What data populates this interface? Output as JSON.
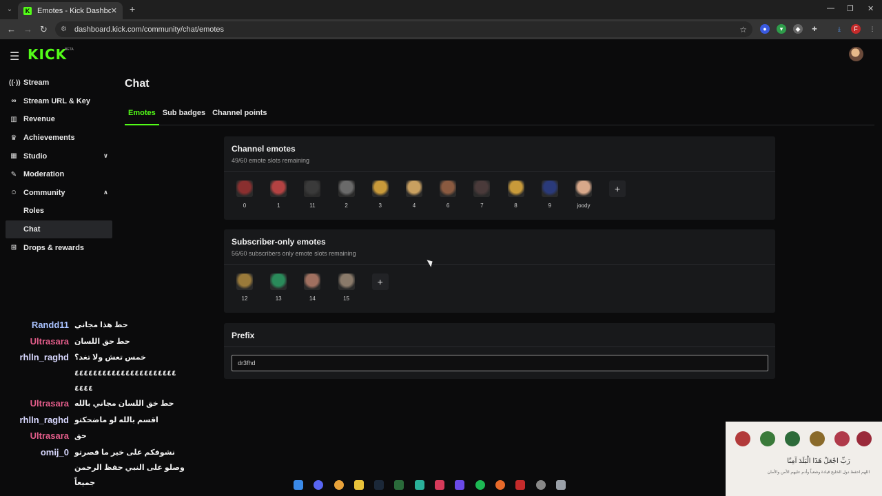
{
  "browser": {
    "tab_title": "Emotes - Kick Dashboard",
    "url": "dashboard.kick.com/community/chat/emotes"
  },
  "header": {
    "logo": "KICK",
    "logo_badge": "BETA"
  },
  "sidebar": {
    "items": [
      {
        "label": "Stream",
        "icon": "broadcast-icon"
      },
      {
        "label": "Stream URL & Key",
        "icon": "link-icon"
      },
      {
        "label": "Revenue",
        "icon": "chart-icon"
      },
      {
        "label": "Achievements",
        "icon": "trophy-icon"
      },
      {
        "label": "Studio",
        "icon": "layout-icon"
      },
      {
        "label": "Moderation",
        "icon": "wrench-icon"
      },
      {
        "label": "Community",
        "icon": "users-icon"
      },
      {
        "label": "Roles"
      },
      {
        "label": "Chat"
      },
      {
        "label": "Drops & rewards",
        "icon": "gift-icon"
      }
    ]
  },
  "main": {
    "title": "Chat",
    "tabs": [
      "Emotes",
      "Sub badges",
      "Channel points"
    ],
    "channel_emotes": {
      "title": "Channel emotes",
      "subtitle": "49/60 emote slots remaining",
      "emotes": [
        {
          "name": "0",
          "color": "#8a2f2f"
        },
        {
          "name": "1",
          "color": "#b34242"
        },
        {
          "name": "11",
          "color": "#3a3a3a"
        },
        {
          "name": "2",
          "color": "#6a6a6a"
        },
        {
          "name": "3",
          "color": "#c99a3a"
        },
        {
          "name": "4",
          "color": "#c9a060"
        },
        {
          "name": "6",
          "color": "#8a5a40"
        },
        {
          "name": "7",
          "color": "#4a3a3a"
        },
        {
          "name": "8",
          "color": "#c89a3a"
        },
        {
          "name": "9",
          "color": "#2a3a7a"
        },
        {
          "name": "joody",
          "color": "#d8a88a"
        }
      ]
    },
    "subscriber_emotes": {
      "title": "Subscriber-only emotes",
      "subtitle": "56/60 subscribers only emote slots remaining",
      "emotes": [
        {
          "name": "12",
          "color": "#9a7a3a"
        },
        {
          "name": "13",
          "color": "#2a8a5a"
        },
        {
          "name": "14",
          "color": "#a07060"
        },
        {
          "name": "15",
          "color": "#8a7a6a"
        }
      ]
    },
    "prefix": {
      "title": "Prefix",
      "value": "dr3fhd"
    }
  },
  "chat_overlay": {
    "lines": [
      {
        "user": "Randd11",
        "color": "#a9c2ff",
        "msg": "حط هذا مجاني"
      },
      {
        "user": "Ultrasara",
        "color": "#e35d8a",
        "msg": "حط حق اللسان"
      },
      {
        "user": "rhlln_raghd",
        "color": "#d8d8ff",
        "msg": "خمس تعش ولا تغد؟"
      },
      {
        "user": "",
        "color": "#ffffff",
        "msg": "٤٤٤٤٤٤٤٤٤٤٤٤٤٤٤٤٤٤٤٤٤٤"
      },
      {
        "user": "",
        "color": "#ffffff",
        "msg": "٤٤٤٤"
      },
      {
        "user": "Ultrasara",
        "color": "#e35d8a",
        "msg": "حط خق اللسان مجاني بالله"
      },
      {
        "user": "rhlln_raghd",
        "color": "#d8d8ff",
        "msg": "اقسم بالله لو ماضحكتو"
      },
      {
        "user": "Ultrasara",
        "color": "#e35d8a",
        "msg": "حق"
      },
      {
        "user": "omij_0",
        "color": "#d8d8ff",
        "msg": "نشوفكم على خير ما قصرتو"
      },
      {
        "user": "",
        "color": "#ffffff",
        "msg": "وصلو على النبي حفظ الرحمن"
      },
      {
        "user": "",
        "color": "#ffffff",
        "msg": "جميعاً"
      }
    ]
  },
  "overlay_banner": {
    "line1": "رَبِّ اجْعَلْ هَذَا الْبَلَدَ آمِنًا",
    "line2": "اللهم احفظ دول الخليج قيادة وشعباً وأدم عليهم الأمن والأمان"
  }
}
